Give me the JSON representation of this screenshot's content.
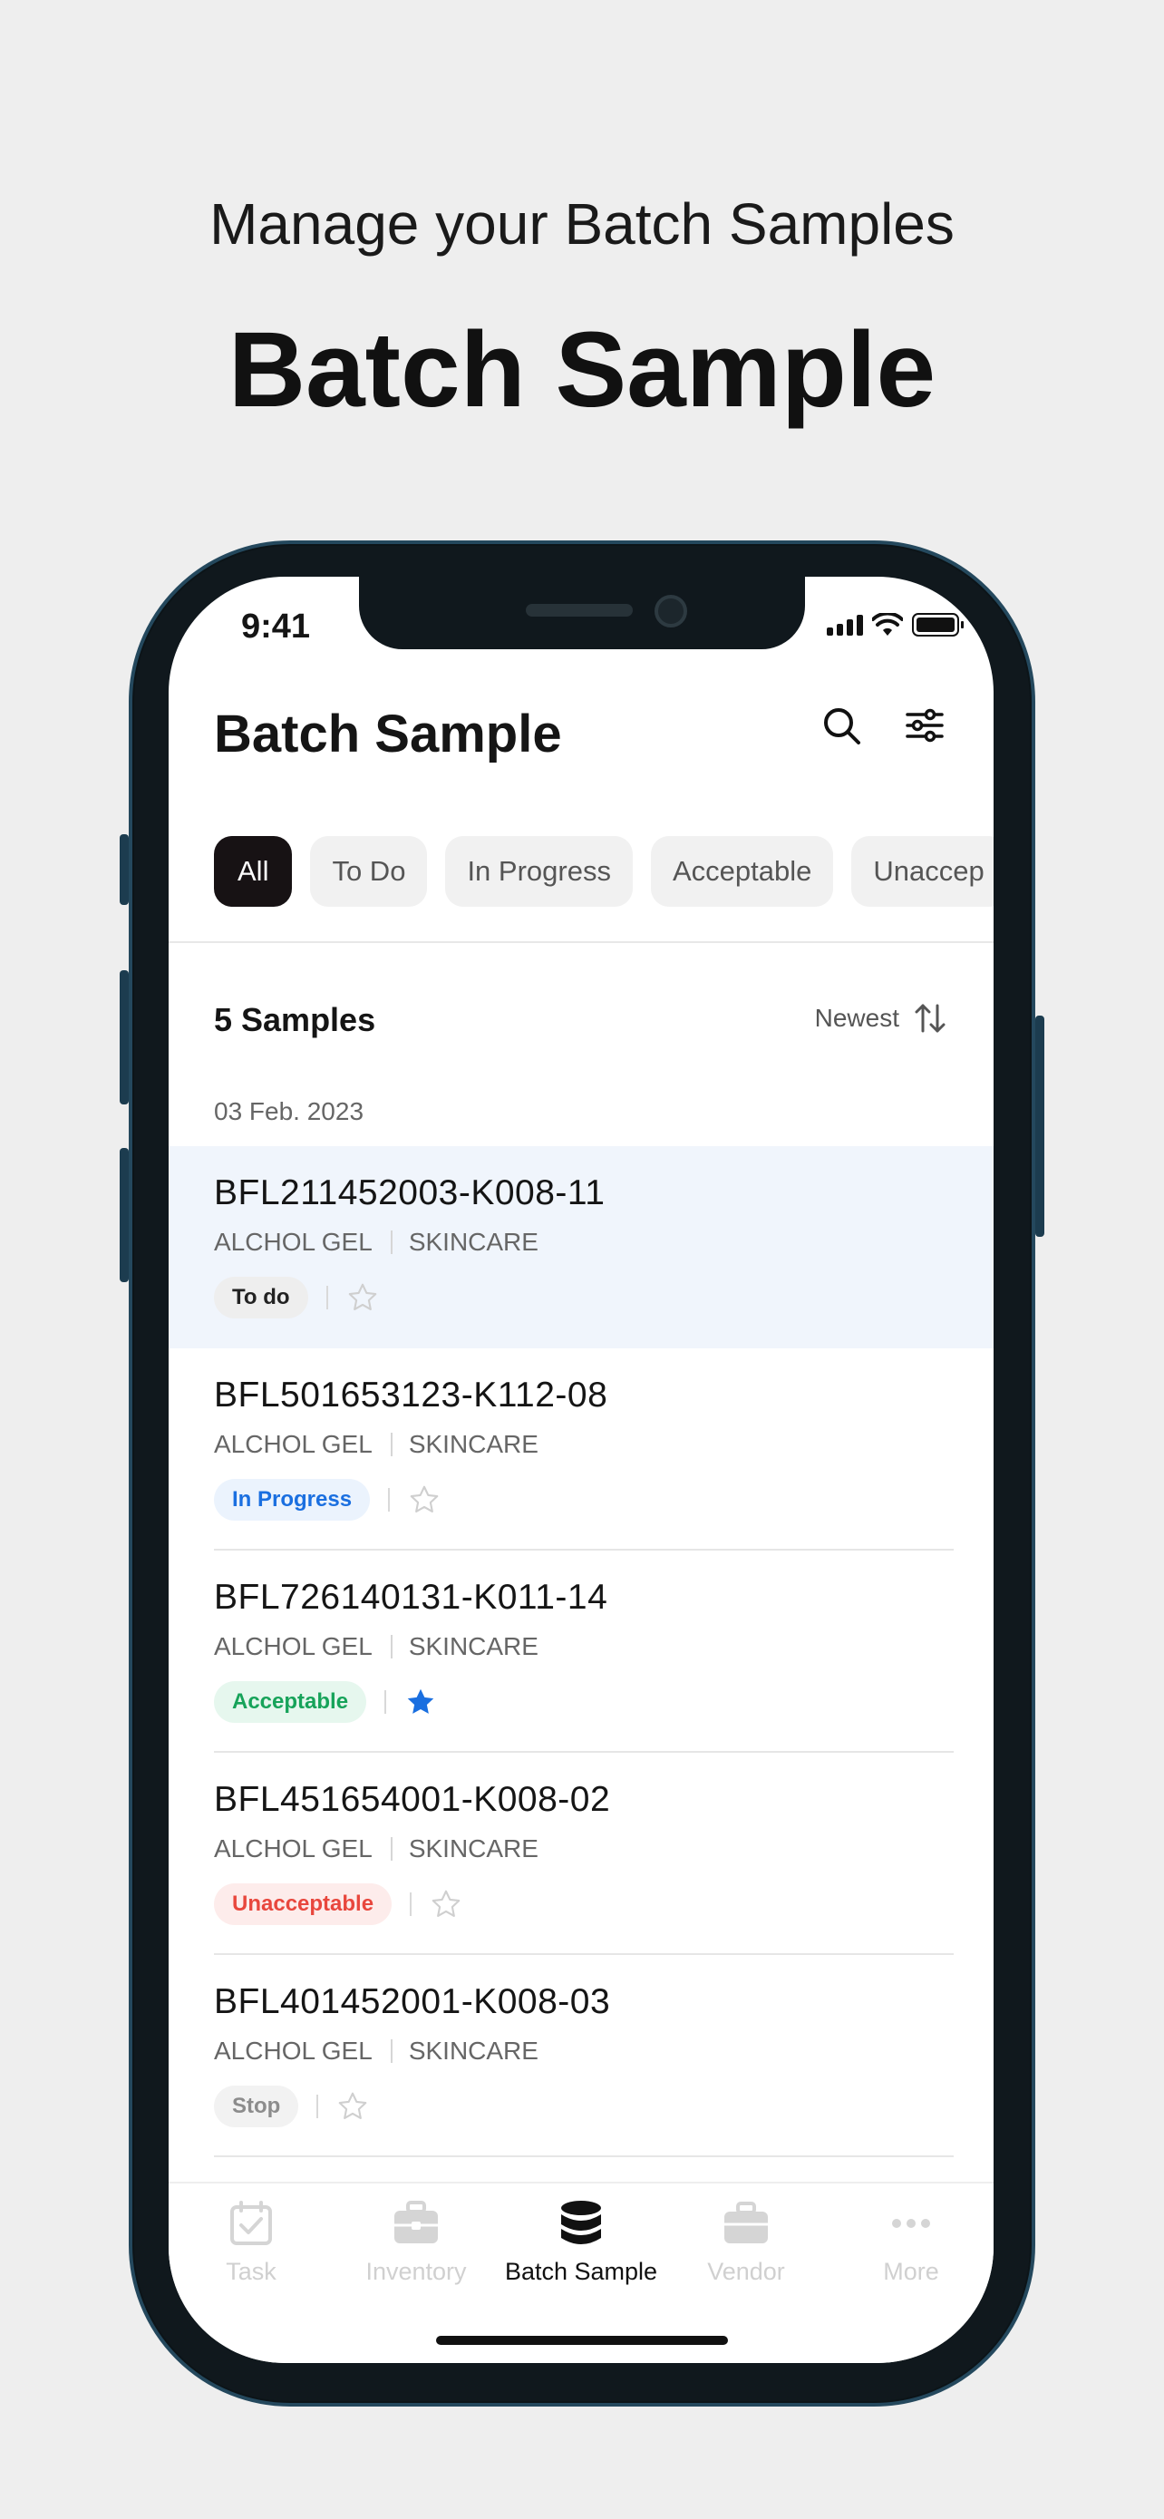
{
  "promo": {
    "subtitle": "Manage your Batch Samples",
    "title": "Batch Sample"
  },
  "status": {
    "time": "9:41"
  },
  "header": {
    "title": "Batch Sample",
    "icons": [
      "search-icon",
      "filter-sliders-icon"
    ]
  },
  "filters": [
    "All",
    "To Do",
    "In Progress",
    "Acceptable",
    "Unaccep"
  ],
  "summary": {
    "count_label": "5 Samples",
    "sort_label": "Newest"
  },
  "date_group": "03 Feb. 2023",
  "samples": [
    {
      "code": "BFL211452003-K008-11",
      "product": "ALCHOL GEL",
      "category": "SKINCARE",
      "status": "To do",
      "starred": false
    },
    {
      "code": "BFL501653123-K112-08",
      "product": "ALCHOL GEL",
      "category": "SKINCARE",
      "status": "In Progress",
      "starred": false
    },
    {
      "code": "BFL726140131-K011-14",
      "product": "ALCHOL GEL",
      "category": "SKINCARE",
      "status": "Acceptable",
      "starred": true
    },
    {
      "code": "BFL451654001-K008-02",
      "product": "ALCHOL GEL",
      "category": "SKINCARE",
      "status": "Unacceptable",
      "starred": false
    },
    {
      "code": "BFL401452001-K008-03",
      "product": "ALCHOL GEL",
      "category": "SKINCARE",
      "status": "Stop",
      "starred": false
    }
  ],
  "status_colors": {
    "To do": {
      "bg": "#eeeeee",
      "fg": "#222222"
    },
    "In Progress": {
      "bg": "#ebf3fd",
      "fg": "#1a6fe0"
    },
    "Acceptable": {
      "bg": "#e6f7ee",
      "fg": "#17a35a"
    },
    "Unacceptable": {
      "bg": "#fdeceb",
      "fg": "#e8473d"
    },
    "Stop": {
      "bg": "#f2f2f2",
      "fg": "#8c8c8c"
    }
  },
  "accent": "#1a6fe0",
  "tabs": [
    {
      "label": "Task",
      "icon": "task-check-icon"
    },
    {
      "label": "Inventory",
      "icon": "inventory-box-icon"
    },
    {
      "label": "Batch Sample",
      "icon": "batch-database-icon",
      "active": true
    },
    {
      "label": "Vendor",
      "icon": "vendor-briefcase-icon"
    },
    {
      "label": "More",
      "icon": "more-dots-icon"
    }
  ]
}
